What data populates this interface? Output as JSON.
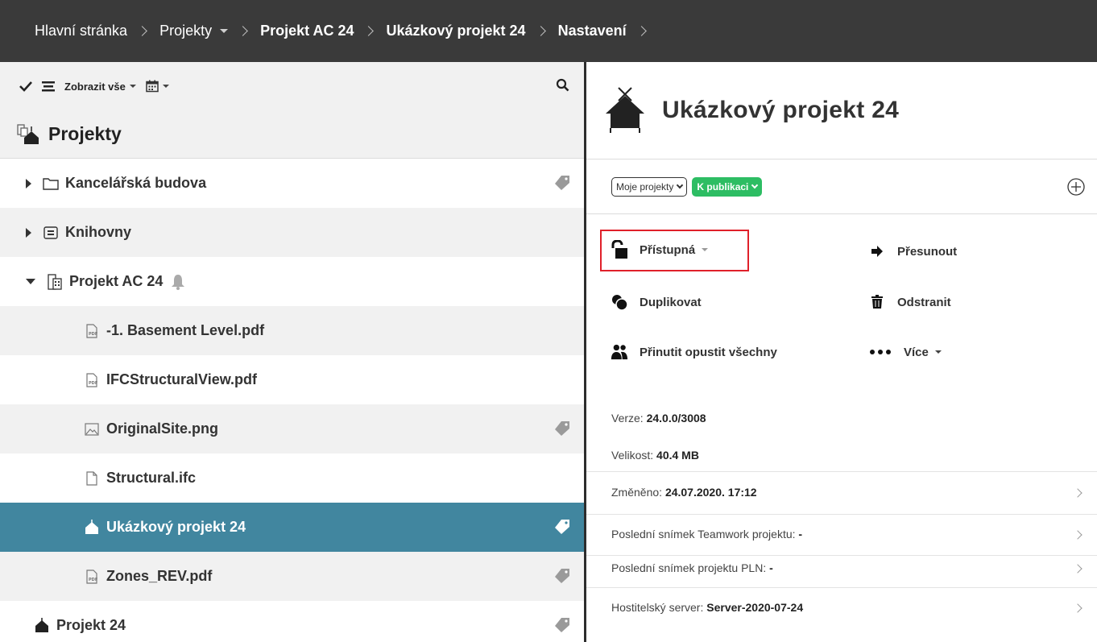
{
  "breadcrumb": [
    {
      "label": "Hlavní stránka",
      "bold": false,
      "caret": false
    },
    {
      "label": "Projekty",
      "bold": false,
      "caret": true
    },
    {
      "label": "Projekt AC 24",
      "bold": true,
      "caret": false
    },
    {
      "label": "Ukázkový projekt 24",
      "bold": true,
      "caret": false
    },
    {
      "label": "Nastavení",
      "bold": true,
      "caret": false
    }
  ],
  "toolbar": {
    "view_label": "Zobrazit vše",
    "icons": [
      "check-icon",
      "sort-icon",
      "calendar-icon",
      "search-icon"
    ]
  },
  "tree": {
    "header": "Projekty",
    "items": [
      {
        "label": "Kancelářská budova",
        "icon": "folder-icon",
        "expand": "collapsed",
        "tag": true,
        "indent": 0
      },
      {
        "label": "Knihovny",
        "icon": "library-icon",
        "expand": "collapsed",
        "tag": false,
        "indent": 0
      },
      {
        "label": "Projekt AC 24",
        "icon": "building-icon",
        "expand": "expanded",
        "tag": false,
        "bell": true,
        "indent": 0
      },
      {
        "label": "-1. Basement Level.pdf",
        "icon": "pdf-icon",
        "expand": "none",
        "tag": false,
        "indent": 1
      },
      {
        "label": "IFCStructuralView.pdf",
        "icon": "pdf-icon",
        "expand": "none",
        "tag": false,
        "indent": 1
      },
      {
        "label": "OriginalSite.png",
        "icon": "image-icon",
        "expand": "none",
        "tag": true,
        "indent": 1
      },
      {
        "label": "Structural.ifc",
        "icon": "file-icon",
        "expand": "none",
        "tag": false,
        "indent": 1
      },
      {
        "label": "Ukázkový projekt 24",
        "icon": "project-icon",
        "expand": "none",
        "tag": true,
        "indent": 1,
        "selected": true
      },
      {
        "label": "Zones_REV.pdf",
        "icon": "pdf-icon",
        "expand": "none",
        "tag": true,
        "indent": 1
      },
      {
        "label": "Projekt 24",
        "icon": "project-icon",
        "expand": "none",
        "tag": true,
        "indent": 0
      }
    ]
  },
  "detail": {
    "title": "Ukázkový projekt 24",
    "filters": {
      "scope": "Moje projekty",
      "status": "K publikaci"
    },
    "actions": {
      "access": "Přístupná",
      "move": "Přesunout",
      "duplicate": "Duplikovat",
      "delete": "Odstranit",
      "force_leave": "Přinutit opustit všechny",
      "more": "Více"
    },
    "info": {
      "version_label": "Verze:",
      "version_value": "24.0.0/3008",
      "size_label": "Velikost:",
      "size_value": "40.4 MB",
      "modified_label": "Změněno:",
      "modified_value": "24.07.2020. 17:12",
      "teamwork_label": "Poslední snímek Teamwork projektu:",
      "teamwork_value": "-",
      "pln_label": "Poslední snímek projektu PLN:",
      "pln_value": "-",
      "host_label": "Hostitelský server:",
      "host_value": "Server-2020-07-24"
    }
  },
  "colors": {
    "topbar": "#3a3a3a",
    "selected_row": "#41869f",
    "status_green": "#2dbd63",
    "highlight_red": "#e0202a"
  }
}
